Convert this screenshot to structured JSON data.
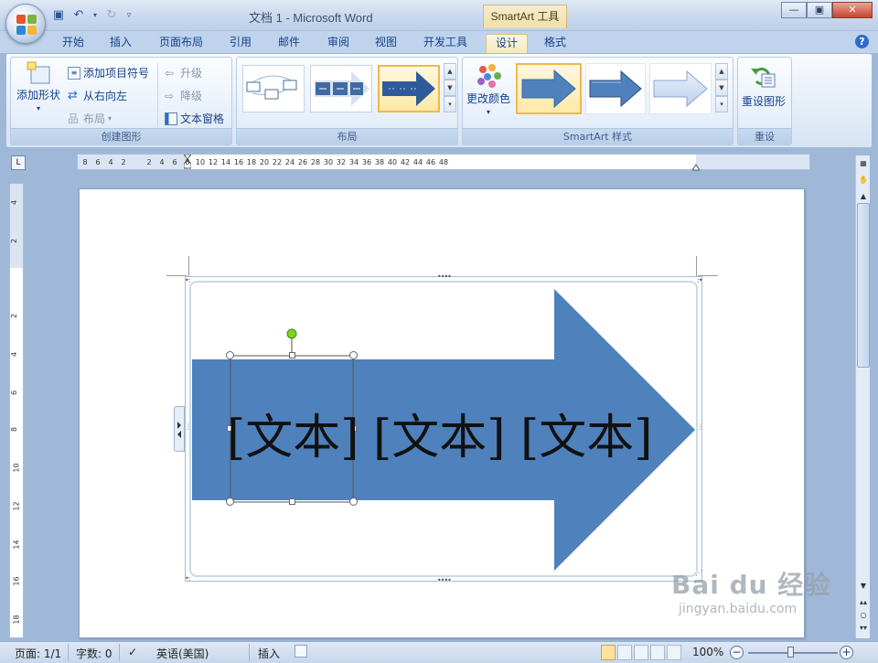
{
  "window": {
    "title": "文档 1 - Microsoft Word",
    "contextual_tools": "SmartArt 工具"
  },
  "tabs": [
    {
      "label": "开始"
    },
    {
      "label": "插入"
    },
    {
      "label": "页面布局"
    },
    {
      "label": "引用"
    },
    {
      "label": "邮件"
    },
    {
      "label": "审阅"
    },
    {
      "label": "视图"
    },
    {
      "label": "开发工具"
    },
    {
      "label": "设计",
      "active": true
    },
    {
      "label": "格式"
    }
  ],
  "ribbon": {
    "create_group": {
      "label": "创建图形",
      "add_shape": "添加形状",
      "add_bullet": "添加项目符号",
      "right_to_left": "从右向左",
      "layout": "布局",
      "promote": "升级",
      "demote": "降级",
      "text_pane": "文本窗格"
    },
    "layout_group": {
      "label": "布局"
    },
    "styles_group": {
      "label": "SmartArt 样式",
      "change_colors": "更改颜色"
    },
    "reset_group": {
      "label": "重设",
      "reset_graphic": "重设图形"
    }
  },
  "ruler": {
    "h_ticks": [
      "8",
      "6",
      "4",
      "2",
      "2",
      "4",
      "6",
      "8",
      "10",
      "12",
      "14",
      "16",
      "18",
      "20",
      "22",
      "24",
      "26",
      "28",
      "30",
      "32",
      "34",
      "36",
      "38",
      "40",
      "42",
      "44",
      "46",
      "48"
    ],
    "v_ticks": [
      "4",
      "2",
      "2",
      "4",
      "6",
      "8",
      "10",
      "12",
      "14",
      "16",
      "18"
    ]
  },
  "smartart": {
    "items": [
      "[文本]",
      "[文本]",
      "[文本]"
    ],
    "arrow_color": "#4f81bd"
  },
  "statusbar": {
    "page": "页面: 1/1",
    "words": "字数: 0",
    "language": "英语(美国)",
    "mode": "插入",
    "zoom": "100%"
  },
  "watermark": {
    "brand": "Bai du 经验",
    "url": "jingyan.baidu.com"
  },
  "colors": {
    "accent": "#4f81bd",
    "tab_active": "#f6e9c0",
    "ribbon_bg": "#e4edf8"
  }
}
